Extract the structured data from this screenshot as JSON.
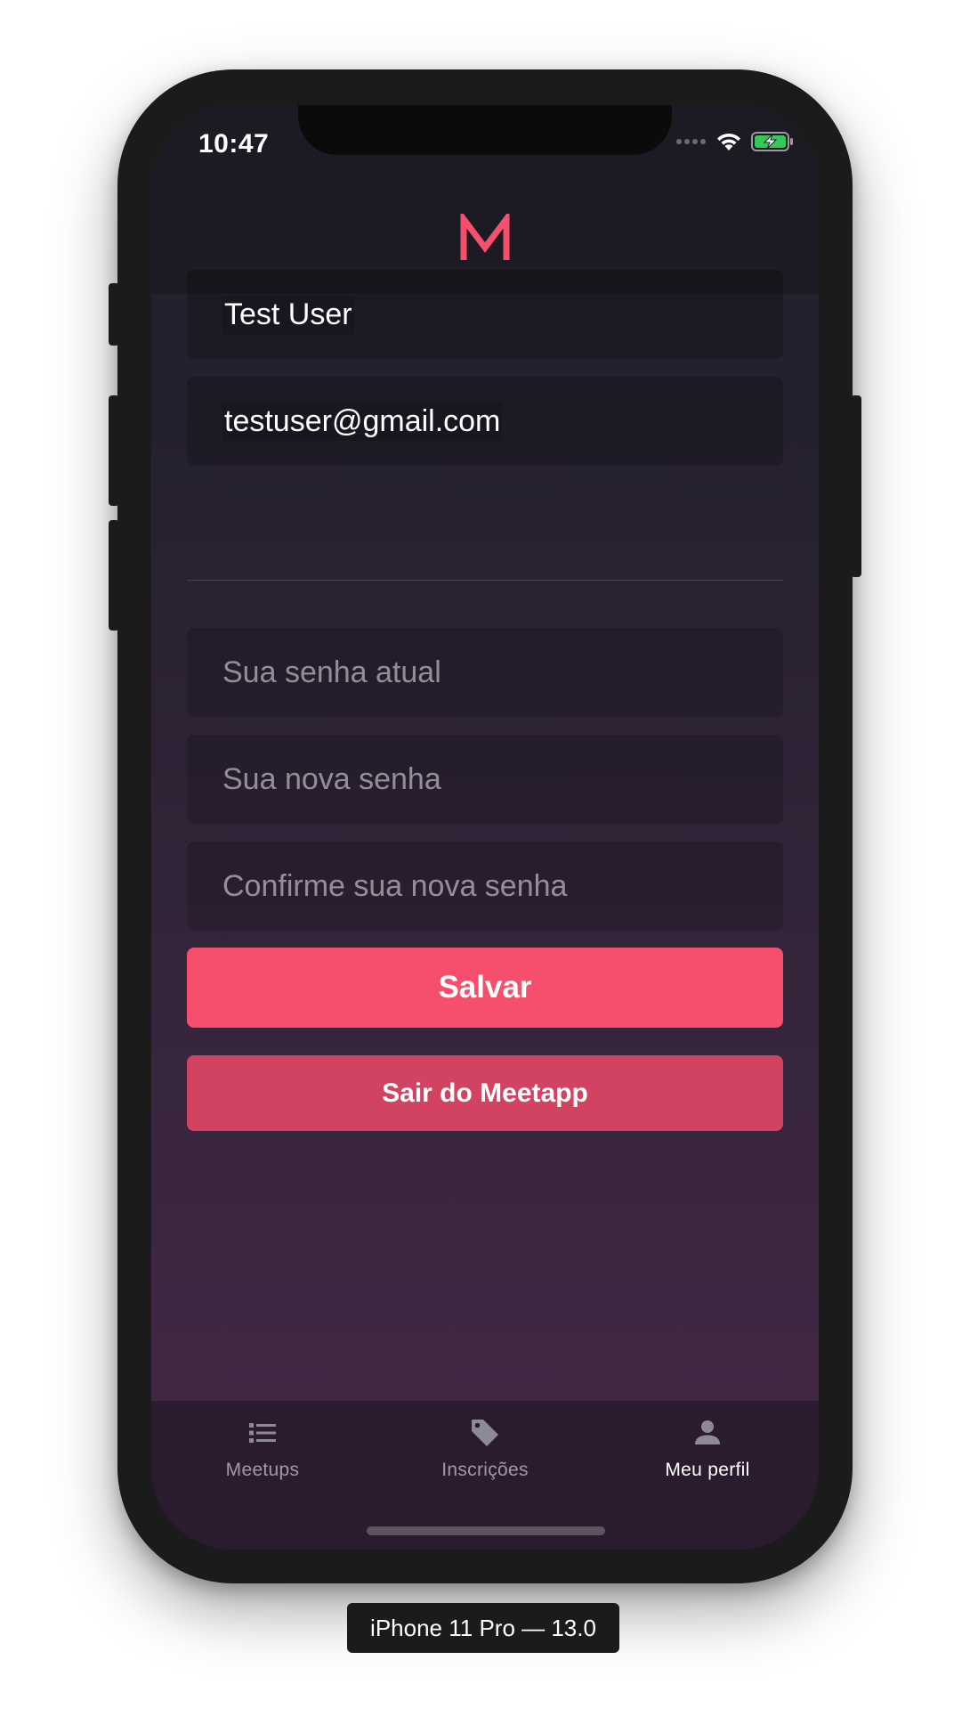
{
  "status_bar": {
    "time": "10:47",
    "icons": [
      "signal-dots-icon",
      "wifi-icon",
      "battery-charging-icon"
    ]
  },
  "header": {
    "logo": "M",
    "logo_color": "#f64f6e"
  },
  "profile_form": {
    "name": {
      "value": "Test User"
    },
    "email": {
      "value": "testuser@gmail.com"
    },
    "current_password": {
      "value": "",
      "placeholder": "Sua senha atual"
    },
    "new_password": {
      "value": "",
      "placeholder": "Sua nova senha"
    },
    "confirm_password": {
      "value": "",
      "placeholder": "Confirme sua nova senha"
    }
  },
  "buttons": {
    "save_label": "Salvar",
    "logout_label": "Sair do Meetapp"
  },
  "tab_bar": {
    "items": [
      {
        "label": "Meetups",
        "icon": "list-icon",
        "active": false
      },
      {
        "label": "Inscrições",
        "icon": "tag-icon",
        "active": false
      },
      {
        "label": "Meu perfil",
        "icon": "person-icon",
        "active": true
      }
    ]
  },
  "colors": {
    "accent": "#f64f6e",
    "logout": "#d14360",
    "background_top": "#24202e",
    "background_bottom": "#432845"
  },
  "device_label": "iPhone 11 Pro — 13.0"
}
